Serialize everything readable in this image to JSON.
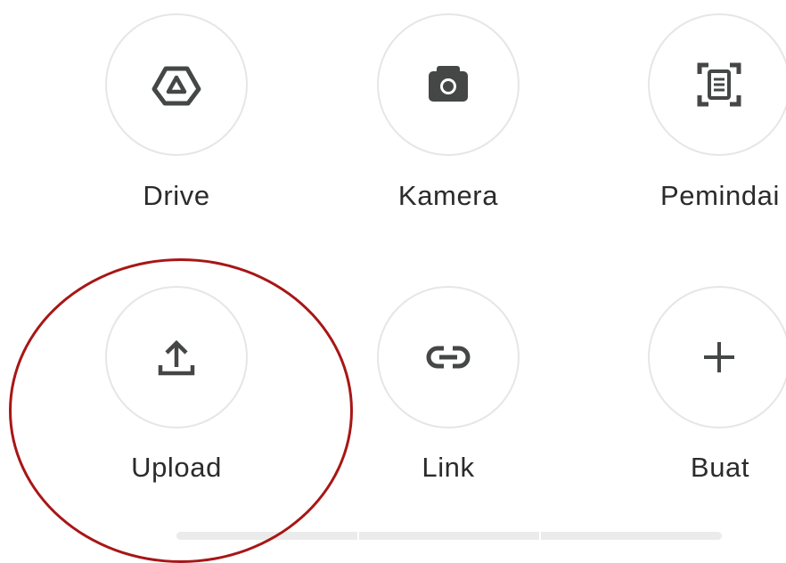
{
  "options": [
    {
      "id": "drive",
      "label": "Drive",
      "icon": "google-drive-icon"
    },
    {
      "id": "kamera",
      "label": "Kamera",
      "icon": "camera-icon"
    },
    {
      "id": "pemindai",
      "label": "Pemindai",
      "icon": "document-scanner-icon"
    },
    {
      "id": "upload",
      "label": "Upload",
      "icon": "upload-icon"
    },
    {
      "id": "link",
      "label": "Link",
      "icon": "link-icon"
    },
    {
      "id": "buat",
      "label": "Buat",
      "icon": "plus-icon"
    }
  ],
  "annotation": {
    "type": "circle",
    "color": "#a81616",
    "target": "upload"
  },
  "colors": {
    "icon": "#444746",
    "label": "#2b2b2b",
    "circle_border": "#e6e6e6",
    "indicator": "#ebebeb"
  }
}
